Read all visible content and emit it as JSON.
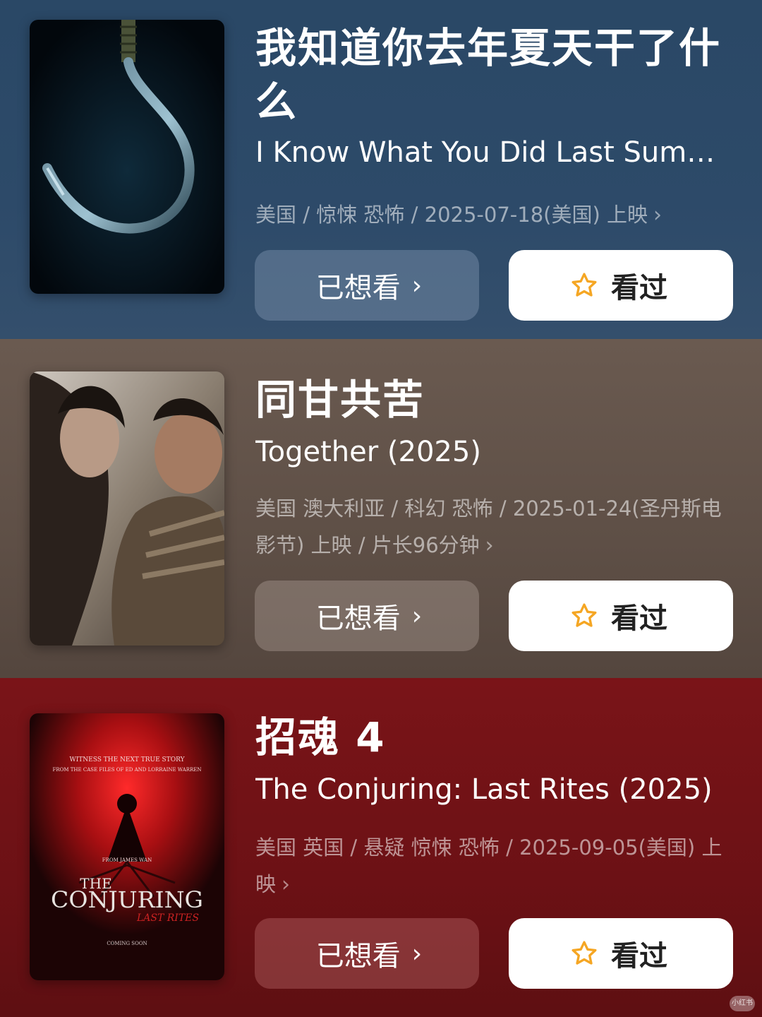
{
  "colors": {
    "card_0_bg": "#2d4a69",
    "card_1_bg": "#5e4f46",
    "card_2_bg": "#6c1115",
    "star_color": "#f5a623",
    "seen_button_bg": "#ffffff"
  },
  "movies": [
    {
      "title_cn": "我知道你去年夏天干了什么",
      "title_en": "I Know What You Did Last Summ...",
      "meta": "美国 / 惊悚 恐怖 / 2025-07-18(美国) 上映",
      "want_label": "已想看",
      "seen_label": "看过",
      "poster_icon": "hook-poster"
    },
    {
      "title_cn": "同甘共苦",
      "title_en": "Together (2025)",
      "meta": "美国 澳大利亚 / 科幻 恐怖 / 2025-01-24(圣丹斯电影节) 上映 / 片长96分钟",
      "want_label": "已想看",
      "seen_label": "看过",
      "poster_icon": "couple-poster"
    },
    {
      "title_cn": "招魂 4",
      "title_en": "The Conjuring: Last Rites (2025)",
      "meta": "美国 英国 / 悬疑 惊悚 恐怖 / 2025-09-05(美国) 上映",
      "want_label": "已想看",
      "seen_label": "看过",
      "poster_icon": "conjuring-poster",
      "poster_text": {
        "top_line1": "WITNESS THE NEXT TRUE STORY",
        "top_line2": "FROM THE CASE FILES OF ED AND LORRAINE WARREN",
        "from": "FROM JAMES WAN",
        "logo_the": "THE",
        "logo_main": "CONJURING",
        "logo_sub": "LAST RITES",
        "coming": "COMING SOON"
      }
    }
  ],
  "watermark": "小红书"
}
